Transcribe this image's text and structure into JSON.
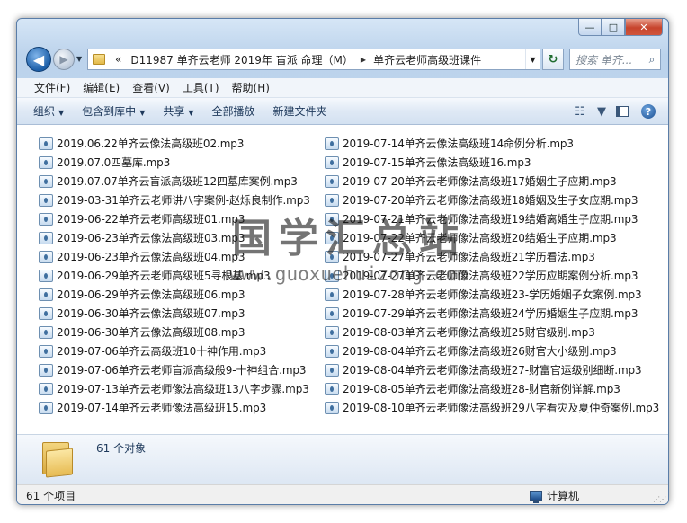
{
  "window": {
    "buttons": {
      "minimize": "—",
      "maximize": "□",
      "close": "✕"
    }
  },
  "nav": {
    "back": "◀",
    "forward": "▶",
    "history": "▼"
  },
  "address": {
    "overflow": "«",
    "parts": [
      "D11987 单齐云老师 2019年 盲派 命理（M）",
      "单齐云老师高级班课件"
    ],
    "separator": "▶",
    "dropdown": "▼"
  },
  "refresh": "↻",
  "search": {
    "placeholder": "搜索 单齐...",
    "icon": "⌕"
  },
  "menu": [
    "文件(F)",
    "编辑(E)",
    "查看(V)",
    "工具(T)",
    "帮助(H)"
  ],
  "commands": {
    "organize": "组织",
    "include_library": "包含到库中",
    "share": "共享",
    "play_all": "全部播放",
    "new_folder": "新建文件夹",
    "caret": "▼",
    "view_icon": "☷",
    "help": "?"
  },
  "files": {
    "left": [
      "2019.06.22单齐云像法高级班02.mp3",
      "2019.07.0四墓库.mp3",
      "2019.07.07单齐云盲派高级班12四墓库案例.mp3",
      "2019-03-31单齐云老师讲八字案例-赵烁良制作.mp3",
      "2019-06-22单齐云老师高级班01.mp3",
      "2019-06-23单齐云像法高级班03.mp3",
      "2019-06-23单齐云像法高级班04.mp3",
      "2019-06-29单齐云老师高级班5寻根基.mp3",
      "2019-06-29单齐云像法高级班06.mp3",
      "2019-06-30单齐云像法高级班07.mp3",
      "2019-06-30单齐云像法高级班08.mp3",
      "2019-07-06单齐云高级班10十神作用.mp3",
      "2019-07-06单齐云老师盲派高级般9-十神组合.mp3",
      "2019-07-13单齐云老师像法高级班13八字步骤.mp3",
      "2019-07-14单齐云老师像法高级班15.mp3"
    ],
    "right": [
      "2019-07-14单齐云像法高级班14命例分析.mp3",
      "2019-07-15单齐云像法高级班16.mp3",
      "2019-07-20单齐云老师像法高级班17婚姻生子应期.mp3",
      "2019-07-20单齐云老师像法高级班18婚姻及生子女应期.mp3",
      "2019-07-21单齐云老师像法高级班19结婚离婚生子应期.mp3",
      "2019-07-22单齐云老师像法高级班20结婚生子应期.mp3",
      "2019-07-27单齐云老师像法高级班21学历看法.mp3",
      "2019-07-27单齐云老师像法高级班22学历应期案例分析.mp3",
      "2019-07-28单齐云老师像法高级班23-学历婚姻子女案例.mp3",
      "2019-07-29单齐云老师像法高级班24学历婚姻生子应期.mp3",
      "2019-08-03单齐云老师像法高级班25财官级别.mp3",
      "2019-08-04单齐云老师像法高级班26财官大小级别.mp3",
      "2019-08-04单齐云老师像法高级班27-财富官运级别细断.mp3",
      "2019-08-05单齐云老师像法高级班28-财官新例详解.mp3",
      "2019-08-10单齐云老师像法高级班29八字看灾及夏仲奇案例.mp3"
    ]
  },
  "scroll": {
    "left": "◀",
    "right": "▶"
  },
  "details": {
    "count": "61 个对象"
  },
  "status": {
    "items": "61 个项目",
    "location": "计算机",
    "grip": "⋰⋰"
  },
  "watermark": {
    "title": "国学汇总站",
    "url": "www.guoxuehuizong.com"
  }
}
